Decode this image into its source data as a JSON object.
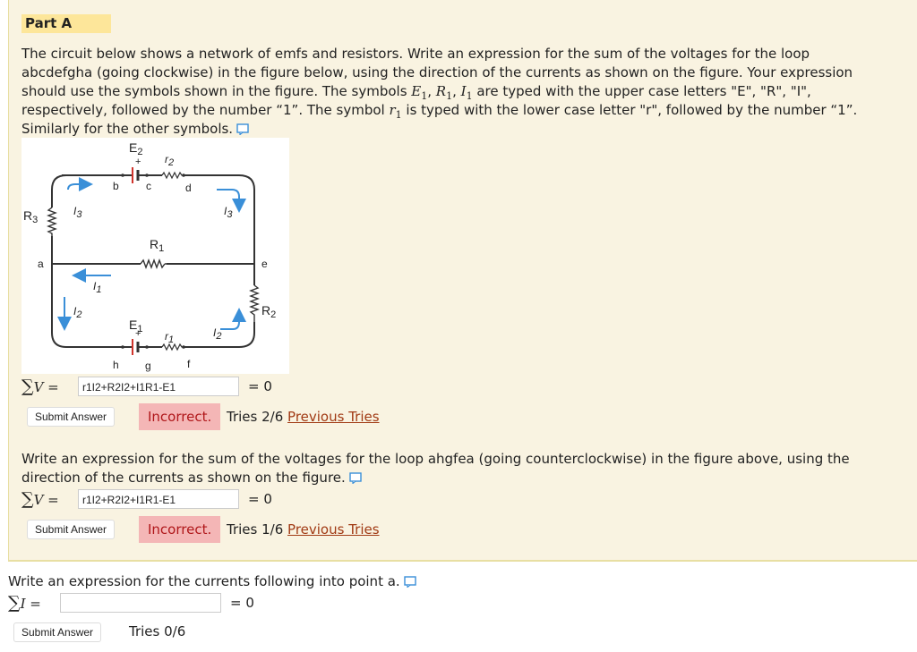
{
  "part": {
    "title": "Part A"
  },
  "intro_html": "The circuit below shows a network of emfs and resistors. Write an expression for the sum of the voltages for the loop abcdefgha (going clockwise) in the figure below, using the direction of the currents as shown on the figure. Your expression should use the symbols shown in the figure. The symbols E₁, R₁, I₁ are typed with the upper case letters \"E\", \"R\", \"I\", respectively, followed by the number “1”. The symbol r₁ is typed with the lower case letter \"r\", followed by the number “1”. Similarly for the other symbols.",
  "intro": {
    "line1": "The circuit below shows a network of emfs and resistors. Write an expression for the sum of the voltages for the loop",
    "line2": "abcdefgha (going clockwise) in the figure below, using the direction of the currents as shown on the figure. Your expression",
    "line3a": "should use the symbols shown in the figure. The symbols ",
    "sym_E1": "E",
    "sub1": "1",
    "sym_R1": "R",
    "sym_I1": "I",
    "line3b": " are typed with the upper case letters \"E\", \"R\", \"I\",",
    "line4a": "respectively, followed by the number “1”. The symbol ",
    "sym_r1": "r",
    "line4b": " is typed with the lower case letter \"r\", followed by the number “1”.",
    "line5": "Similarly for the other symbols."
  },
  "figure": {
    "nodes": [
      "a",
      "b",
      "c",
      "d",
      "e",
      "f",
      "g",
      "h"
    ],
    "labels": {
      "E2": "E",
      "E2s": "2",
      "r2": "r",
      "r2s": "2",
      "R3": "R",
      "R3s": "3",
      "I3L": "I",
      "I3Ls": "3",
      "I3R": "I",
      "I3Rs": "3",
      "R1": "R",
      "R1s": "1",
      "I1": "I",
      "I1s": "1",
      "I2L": "I",
      "I2Ls": "2",
      "I2R": "I",
      "I2Rs": "2",
      "R2": "R",
      "R2s": "2",
      "E1": "E",
      "E1s": "1",
      "r1": "r",
      "r1s": "1",
      "plus": "+"
    },
    "colors": {
      "wire": "#333333",
      "arrow": "#3a8fd8",
      "emf": "#d0342c"
    }
  },
  "q1": {
    "sum_label": "V =",
    "answer": "r1I2+R2I2+I1R1-E1",
    "equals": "= 0",
    "submit": "Submit Answer",
    "status": "Incorrect.",
    "tries": "Tries 2/6",
    "previous": "Previous Tries"
  },
  "q2": {
    "prompt_line1": "Write an expression for the sum of the voltages for the loop ahgfea (going counterclockwise) in the figure above, using the",
    "prompt_line2": "direction of the currents as shown on the figure.",
    "sum_label": "V =",
    "answer": "r1I2+R2I2+I1R1-E1",
    "equals": "= 0",
    "submit": "Submit Answer",
    "status": "Incorrect.",
    "tries": "Tries 1/6",
    "previous": "Previous Tries"
  },
  "q3": {
    "prompt": "Write an expression for the currents following into point a.",
    "sum_label": "I =",
    "answer": "",
    "equals": "= 0",
    "submit": "Submit Answer",
    "tries": "Tries 0/6"
  }
}
